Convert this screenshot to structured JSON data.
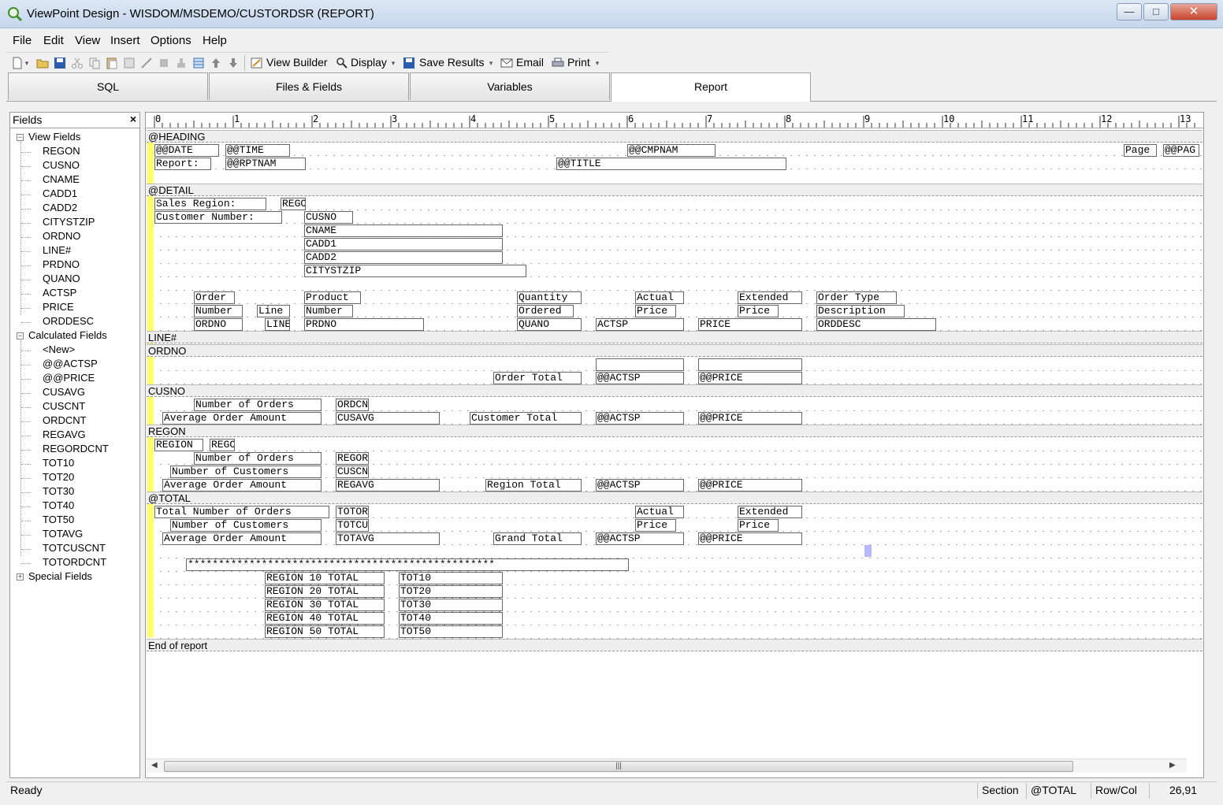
{
  "window": {
    "title": "ViewPoint Design - WISDOM/MSDEMO/CUSTORDSR (REPORT)",
    "minimize_glyph": "—",
    "maximize_glyph": "□",
    "close_glyph": "✕"
  },
  "menu": [
    "File",
    "Edit",
    "View",
    "Insert",
    "Options",
    "Help"
  ],
  "toolbar": {
    "view_builder": "View Builder",
    "display": "Display",
    "save_results": "Save Results",
    "email": "Email",
    "print": "Print",
    "dropdown_glyph": "▾"
  },
  "tabs": [
    "SQL",
    "Files & Fields",
    "Variables",
    "Report"
  ],
  "active_tab": "Report",
  "fields_panel": {
    "title": "Fields",
    "close_glyph": "×",
    "groups": [
      {
        "label": "View Fields",
        "toggle": "−",
        "items": [
          "REGON",
          "CUSNO",
          "CNAME",
          "CADD1",
          "CADD2",
          "CITYSTZIP",
          "ORDNO",
          "LINE#",
          "PRDNO",
          "QUANO",
          "ACTSP",
          "PRICE",
          "ORDDESC"
        ]
      },
      {
        "label": "Calculated Fields",
        "toggle": "−",
        "items": [
          "<New>",
          "@@ACTSP",
          "@@PRICE",
          "CUSAVG",
          "CUSCNT",
          "ORDCNT",
          "REGAVG",
          "REGORDCNT",
          "TOT10",
          "TOT20",
          "TOT30",
          "TOT40",
          "TOT50",
          "TOTAVG",
          "TOTCUSCNT",
          "TOTORDCNT"
        ]
      },
      {
        "label": "Special Fields",
        "toggle": "+",
        "items": []
      }
    ]
  },
  "ruler": [
    "0",
    "1",
    "2",
    "3",
    "4",
    "5",
    "6",
    "7",
    "8",
    "9",
    "10",
    "11",
    "12",
    "13"
  ],
  "sections": [
    "@HEADING",
    "@DETAIL",
    "LINE#",
    "ORDNO",
    "CUSNO",
    "REGON",
    "@TOTAL",
    "End of report"
  ],
  "fields": {
    "h_date": "@@DATE",
    "h_time": "@@TIME",
    "h_cmpnam": "@@CMPNAM",
    "h_page_lbl": "Page",
    "h_pag": "@@PAG",
    "h_report_lbl": "Report:",
    "h_rptnam": "@@RPTNAM",
    "h_title": "@@TITLE",
    "d_sales_region": "Sales Region:",
    "d_rego": "REGO",
    "d_custnum_lbl": "Customer Number:",
    "d_cusno": "CUSNO",
    "d_cname": "CNAME",
    "d_cadd1": "CADD1",
    "d_cadd2": "CADD2",
    "d_citystzip": "CITYSTZIP",
    "d_order": "Order",
    "d_number1": "Number",
    "d_ordno": "ORDNO",
    "d_line_lbl": "Line",
    "d_line": "LINE",
    "d_product": "Product",
    "d_number2": "Number",
    "d_prdno": "PRDNO",
    "d_quantity": "Quantity",
    "d_ordered": "Ordered",
    "d_quano": "QUANO",
    "d_actsp": "ACTSP",
    "d_actual": "Actual",
    "d_price_lbl1": "Price",
    "d_extended": "Extended",
    "d_price_lbl2": "Price",
    "d_price": "PRICE",
    "d_ordertype": "Order Type",
    "d_description": "Description",
    "d_orddesc": "ORDDESC",
    "o_ordertotal": "Order Total",
    "o_actsp": "@@ACTSP",
    "o_price": "@@PRICE",
    "c_numorders": "Number of Orders",
    "c_ordcn": "ORDCN",
    "c_avgorder": "Average Order Amount",
    "c_cusavg": "CUSAVG",
    "c_custtotal": "Customer Total",
    "c_actsp": "@@ACTSP",
    "c_price": "@@PRICE",
    "r_region": "REGION",
    "r_rego": "REGO",
    "r_numorders": "Number of Orders",
    "r_regor": "REGOR",
    "r_numcust": "Number of Customers",
    "r_cuscn": "CUSCN",
    "r_avgorder": "Average Order Amount",
    "r_regavg": "REGAVG",
    "r_regtotal": "Region Total",
    "r_actsp": "@@ACTSP",
    "r_price": "@@PRICE",
    "t_totnumorders": "Total Number of Orders",
    "t_totor": "TOTOR",
    "t_actual": "Actual",
    "t_extended": "Extended",
    "t_numcust": "Number of Customers",
    "t_totcu": "TOTCU",
    "t_price1": "Price",
    "t_price2": "Price",
    "t_avgorder": "Average Order Amount",
    "t_totavg": "TOTAVG",
    "t_grandtotal": "Grand Total",
    "t_actsp": "@@ACTSP",
    "t_price": "@@PRICE",
    "t_stars": "**************************************************",
    "t_reg10": "REGION 10 TOTAL",
    "t_reg20": "REGION 20 TOTAL",
    "t_reg30": "REGION 30 TOTAL",
    "t_reg40": "REGION 40 TOTAL",
    "t_reg50": "REGION 50 TOTAL",
    "t_tot10": "TOT10",
    "t_tot20": "TOT20",
    "t_tot30": "TOT30",
    "t_tot40": "TOT40",
    "t_tot50": "TOT50"
  },
  "scrollbar": {
    "grip": "|||",
    "left_arrow": "◀",
    "right_arrow": "▶"
  },
  "status": {
    "message": "Ready",
    "section_label": "Section",
    "section_value": "@TOTAL",
    "rowcol_label": "Row/Col",
    "rowcol_value": "26,91"
  }
}
